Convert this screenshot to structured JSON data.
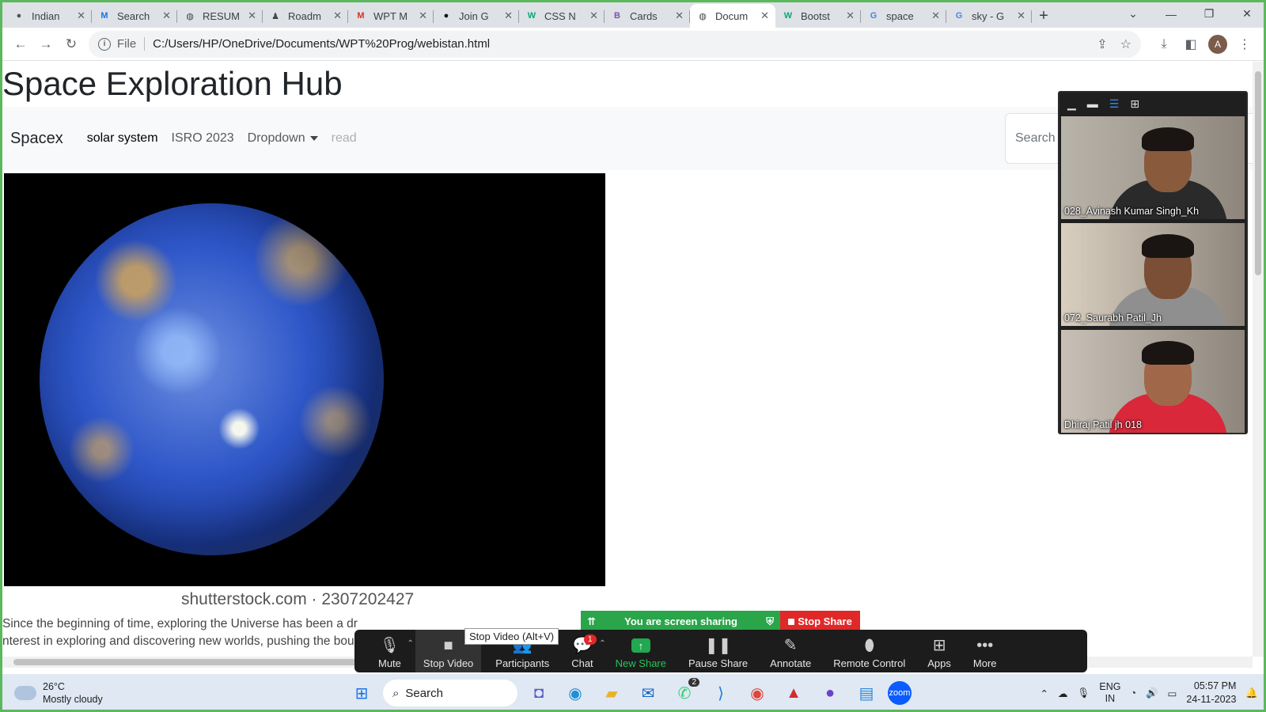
{
  "browser": {
    "tabs": [
      {
        "label": "Indian",
        "icon": "site-icon",
        "glyph": "●",
        "color": "#555555"
      },
      {
        "label": "Search",
        "icon": "medium-icon",
        "glyph": "M",
        "color": "#1a73e8"
      },
      {
        "label": "RESUM",
        "icon": "globe-icon",
        "glyph": "◍",
        "color": "#444444"
      },
      {
        "label": "Roadm",
        "icon": "roadmap-icon",
        "glyph": "♟",
        "color": "#444444"
      },
      {
        "label": "WPT M",
        "icon": "gmail-icon",
        "glyph": "M",
        "color": "#d93025"
      },
      {
        "label": "Join G",
        "icon": "github-icon",
        "glyph": "●",
        "color": "#111111"
      },
      {
        "label": "CSS N",
        "icon": "w3schools-icon",
        "glyph": "W",
        "color": "#04aa6d"
      },
      {
        "label": "Cards",
        "icon": "bootstrap-icon",
        "glyph": "B",
        "color": "#7952b3"
      },
      {
        "label": "Docum",
        "icon": "globe-icon",
        "glyph": "◍",
        "color": "#444444",
        "active": true
      },
      {
        "label": "Bootst",
        "icon": "w3schools-icon",
        "glyph": "W",
        "color": "#04aa6d"
      },
      {
        "label": "space",
        "icon": "google-icon",
        "glyph": "G",
        "color": "#4285f4"
      },
      {
        "label": "sky - G",
        "icon": "google-icon",
        "glyph": "G",
        "color": "#4285f4"
      }
    ],
    "new_tab_label": "+",
    "scheme_label": "File",
    "url": "C:/Users/HP/OneDrive/Documents/WPT%20Prog/webistan.html",
    "profile_initial": "A"
  },
  "page": {
    "title": "Space Exploration Hub",
    "navbar": {
      "brand": "Spacex",
      "links": [
        {
          "label": "solar system",
          "state": "active"
        },
        {
          "label": "ISRO 2023",
          "state": "normal"
        },
        {
          "label": "Dropdown",
          "state": "dropdown"
        },
        {
          "label": "read",
          "state": "disabled"
        }
      ],
      "search_placeholder": "Search"
    },
    "image_caption": "shutterstock.com · 2307202427",
    "paragraph_line1": "Since the beginning of time, exploring the Universe has been a dr",
    "paragraph_line2": "nterest in exploring and discovering new worlds, pushing the bou"
  },
  "zoom": {
    "participants": [
      {
        "name": "028_Avinash Kumar Singh_Kh",
        "bg": "#b9b4aa",
        "shirt": "#2a2a2a",
        "skin": "#8a5a3c"
      },
      {
        "name": "072_Saurabh Patil_Jh",
        "bg": "#d9cfc0",
        "shirt": "#8f8f8f",
        "skin": "#7a4f35"
      },
      {
        "name": "Dhiraj Patil jh 018",
        "bg": "#c8c0b6",
        "shirt": "#d8283a",
        "skin": "#a06848"
      }
    ],
    "sharing_text": "You are screen sharing",
    "stop_share_label": "Stop Share",
    "tooltip": "Stop Video (Alt+V)",
    "toolbar": [
      {
        "label": "Mute",
        "icon": "microphone-icon",
        "glyph": "🎙",
        "arrow": true
      },
      {
        "label": "Stop Video",
        "icon": "video-camera-icon",
        "glyph": "■",
        "highlight": true
      },
      {
        "label": "Participants",
        "icon": "participants-icon",
        "glyph": "👥"
      },
      {
        "label": "Chat",
        "icon": "chat-icon",
        "glyph": "💬",
        "badge": "1",
        "arrow": true
      },
      {
        "label": "New Share",
        "icon": "share-arrow-icon",
        "glyph": "↑",
        "green": true
      },
      {
        "label": "Pause Share",
        "icon": "pause-icon",
        "glyph": "❚❚"
      },
      {
        "label": "Annotate",
        "icon": "pencil-icon",
        "glyph": "✎"
      },
      {
        "label": "Remote Control",
        "icon": "mouse-icon",
        "glyph": "⬮"
      },
      {
        "label": "Apps",
        "icon": "apps-icon",
        "glyph": "⊞"
      },
      {
        "label": "More",
        "icon": "more-dots-icon",
        "glyph": "•••"
      }
    ]
  },
  "taskbar": {
    "weather_temp": "26°C",
    "weather_desc": "Mostly cloudy",
    "search_label": "Search",
    "apps": [
      {
        "icon": "windows-start-icon",
        "glyph": "⊞",
        "color": "#1a73e8"
      },
      {
        "icon": "teams-chat-icon",
        "glyph": "◘",
        "color": "#5b5fc7"
      },
      {
        "icon": "edge-icon",
        "glyph": "◉",
        "color": "#1f8fd6"
      },
      {
        "icon": "file-explorer-icon",
        "glyph": "▰",
        "color": "#e8b32a"
      },
      {
        "icon": "mail-icon",
        "glyph": "✉",
        "color": "#1667c2"
      },
      {
        "icon": "whatsapp-icon",
        "glyph": "✆",
        "color": "#25d366",
        "badge": "2"
      },
      {
        "icon": "vscode-icon",
        "glyph": "⟩",
        "color": "#1f7ad8"
      },
      {
        "icon": "chrome-icon",
        "glyph": "◉",
        "color": "#e2453c"
      },
      {
        "icon": "acrobat-icon",
        "glyph": "▲",
        "color": "#d42b2b"
      },
      {
        "icon": "github-desktop-icon",
        "glyph": "●",
        "color": "#6e40c9"
      },
      {
        "icon": "notepad-icon",
        "glyph": "▤",
        "color": "#2b88d8"
      },
      {
        "icon": "zoom-icon",
        "glyph": "zoom",
        "color": "#0b5cff"
      }
    ],
    "lang_top": "ENG",
    "lang_bottom": "IN",
    "time": "05:57 PM",
    "date": "24-11-2023"
  }
}
